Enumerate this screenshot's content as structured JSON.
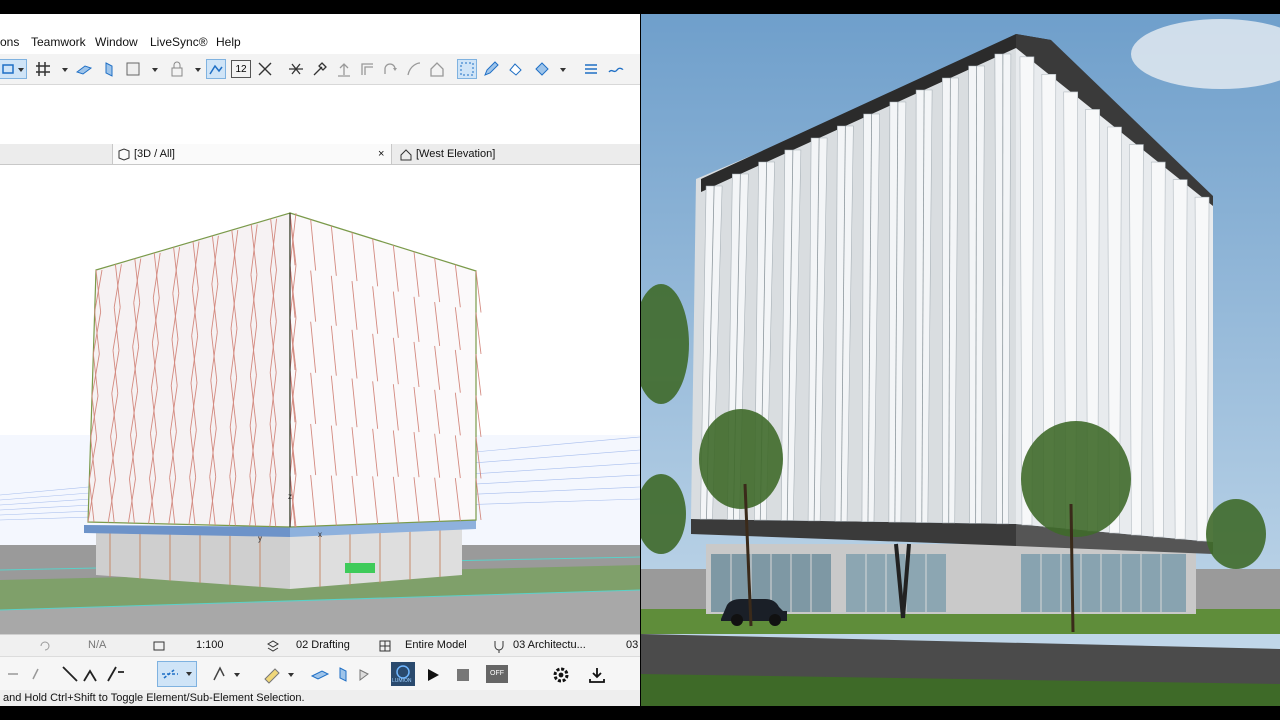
{
  "menu": {
    "items": [
      "ons",
      "Teamwork",
      "Window",
      "LiveSync®",
      "Help"
    ]
  },
  "toolbar": {
    "icons": [
      "layer-dropdown-icon",
      "grid-snap-icon",
      "slab-icon",
      "wall-icon",
      "selection-box-icon",
      "lock-icon",
      "trace-icon",
      "dimension-icon",
      "intersect-icon",
      "split-icon",
      "adjust-icon",
      "elevate-icon",
      "offset-icon",
      "rotate-icon",
      "house-icon",
      "magic-wand-icon",
      "edit-pen-icon",
      "fill-icon",
      "render-icon",
      "settings-menu-icon",
      "mesh-icon"
    ],
    "counter_label": "12"
  },
  "tabs": [
    {
      "label": "[3D / All]",
      "close": "×"
    },
    {
      "label": "[West Elevation]"
    }
  ],
  "tab_indicator": "----",
  "status": {
    "na": "N/A",
    "scale": "1:100",
    "layer_set": "02 Drafting",
    "model_view": "Entire Model",
    "pen_set": "03 Architectu...",
    "extra": "03"
  },
  "bottom_tools": {
    "lumion_label": "LUMION",
    "off_label": "OFF"
  },
  "hint": "and Hold Ctrl+Shift to Toggle Element/Sub-Element Selection.",
  "colors": {
    "accent_blue": "#1f6fc5",
    "toolbar_bg": "#f3f3f3",
    "active_icon_bg": "#cfe4f7"
  }
}
